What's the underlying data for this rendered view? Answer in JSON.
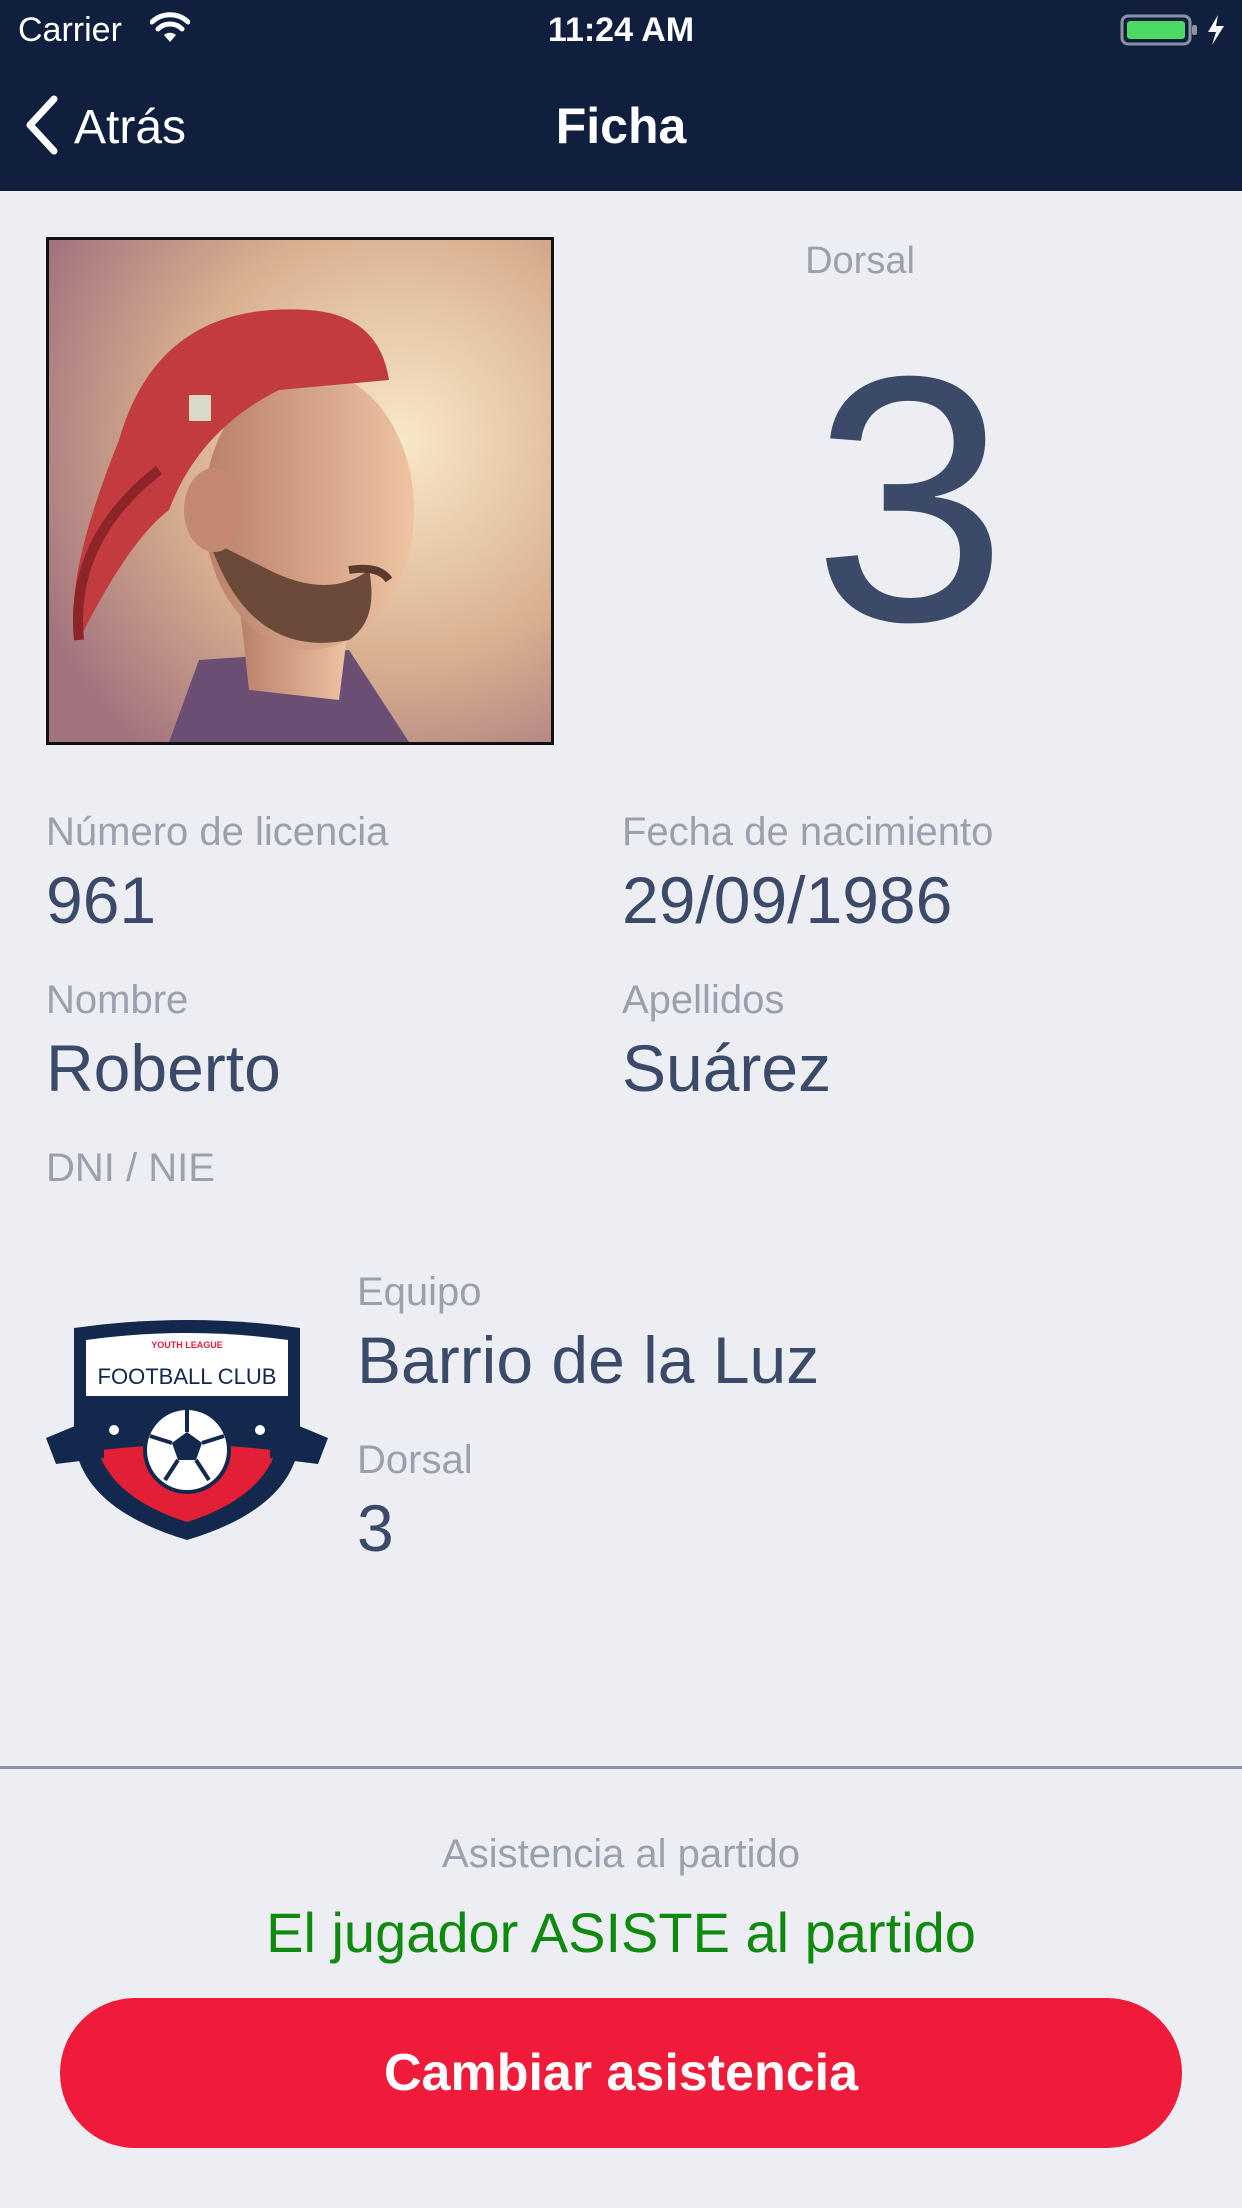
{
  "status_bar": {
    "carrier": "Carrier",
    "time": "11:24 AM"
  },
  "nav": {
    "back_label": "Atrás",
    "title": "Ficha"
  },
  "player": {
    "dorsal_label": "Dorsal",
    "dorsal_number": "3",
    "license_label": "Número de licencia",
    "license_value": "961",
    "birth_label": "Fecha de nacimiento",
    "birth_value": "29/09/1986",
    "name_label": "Nombre",
    "name_value": "Roberto",
    "surname_label": "Apellidos",
    "surname_value": "Suárez",
    "dni_label": "DNI / NIE"
  },
  "team": {
    "logo_top_text": "YOUTH LEAGUE",
    "logo_text": "FOOTBALL CLUB",
    "team_label": "Equipo",
    "team_value": "Barrio de la Luz",
    "dorsal_label": "Dorsal",
    "dorsal_value": "3"
  },
  "attendance": {
    "label": "Asistencia al partido",
    "status": "El jugador ASISTE al partido",
    "button_label": "Cambiar asistencia"
  },
  "colors": {
    "nav_bg": "#0f1f3d",
    "accent_red": "#ef1b3a",
    "status_green": "#0f8a0f",
    "value_text": "#3a4a68"
  }
}
